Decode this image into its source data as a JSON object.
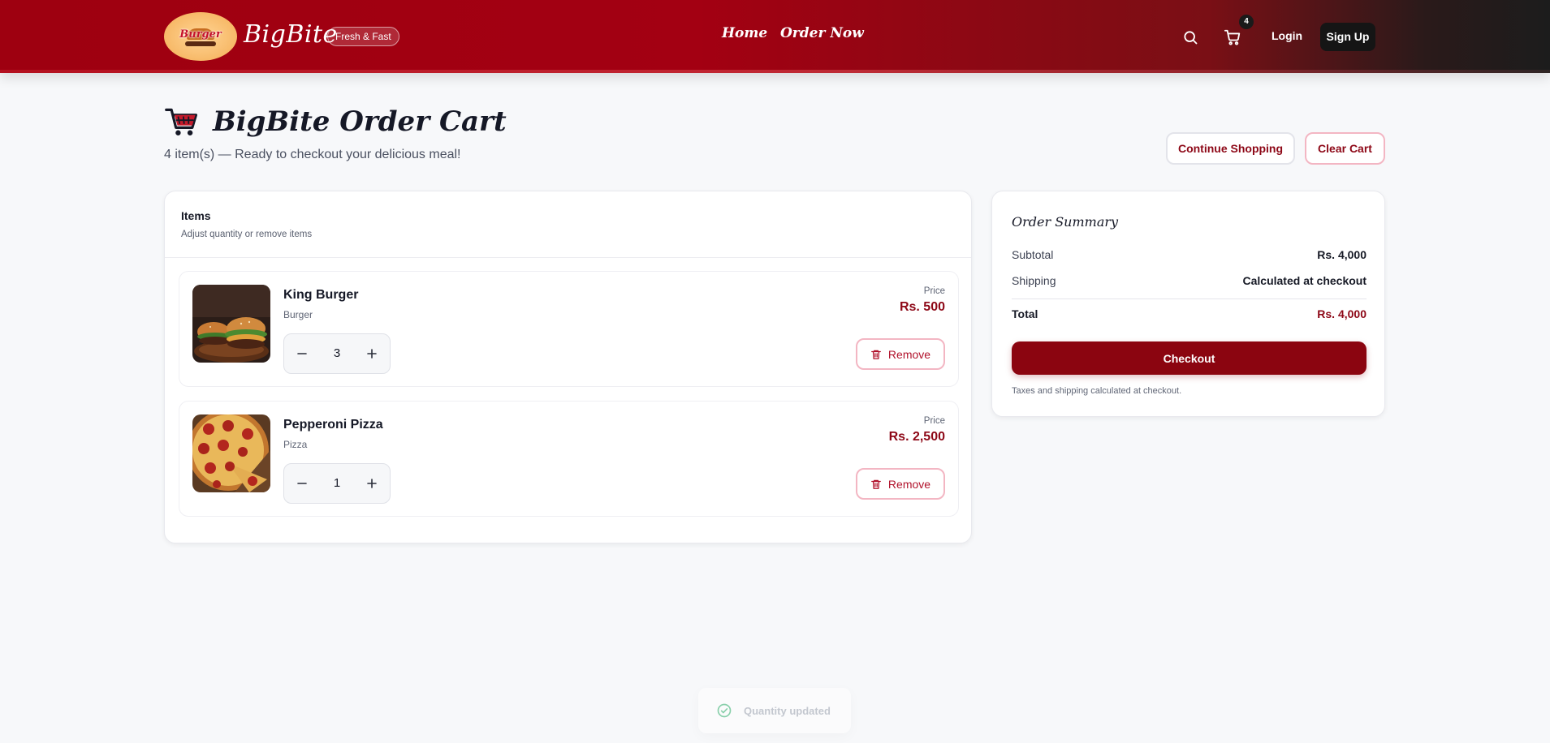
{
  "header": {
    "logo_text": "Burger",
    "brand": "BigBite",
    "tagline": "Fresh & Fast",
    "nav": {
      "home": "Home",
      "order_now": "Order Now"
    },
    "cart_count": "4",
    "login": "Login",
    "signup": "Sign Up"
  },
  "page": {
    "title": "BigBite Order Cart",
    "subtitle": "4 item(s) — Ready to checkout your delicious meal!",
    "continue_shopping": "Continue Shopping",
    "clear_cart": "Clear Cart"
  },
  "items_section": {
    "title": "Items",
    "description": "Adjust quantity or remove items",
    "items": [
      {
        "name": "King Burger",
        "category": "Burger",
        "quantity": "3",
        "price_label": "Price",
        "price": "Rs. 500",
        "remove": "Remove"
      },
      {
        "name": "Pepperoni Pizza",
        "category": "Pizza",
        "quantity": "1",
        "price_label": "Price",
        "price": "Rs. 2,500",
        "remove": "Remove"
      }
    ]
  },
  "summary": {
    "title": "Order Summary",
    "subtotal_label": "Subtotal",
    "subtotal_value": "Rs. 4,000",
    "shipping_label": "Shipping",
    "shipping_value": "Calculated at checkout",
    "total_label": "Total",
    "total_value": "Rs. 4,000",
    "checkout": "Checkout",
    "note": "Taxes and shipping calculated at checkout."
  },
  "toast": {
    "message": "Quantity updated"
  },
  "colors": {
    "brand_red": "#8b0510",
    "header_red": "#a30012",
    "accent_pink": "#f3b6c3"
  }
}
